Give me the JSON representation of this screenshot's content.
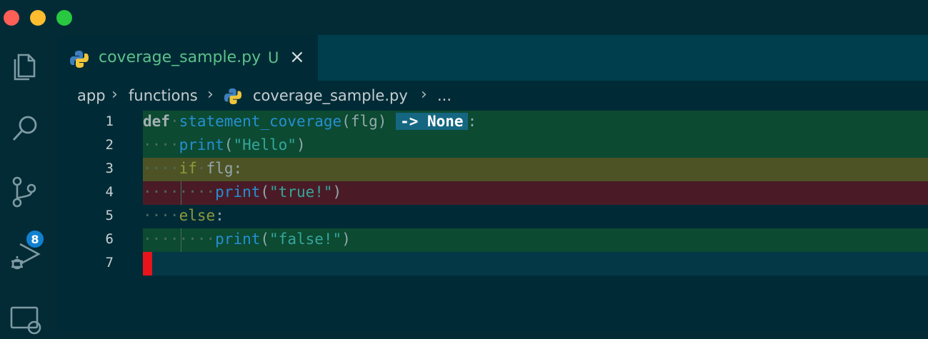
{
  "window": {
    "traffic_lights": [
      "close",
      "minimize",
      "zoom"
    ]
  },
  "activity_bar": {
    "items": [
      {
        "name": "explorer-icon"
      },
      {
        "name": "search-icon"
      },
      {
        "name": "source-control-icon",
        "badge": "8"
      },
      {
        "name": "run-debug-icon"
      },
      {
        "name": "remote-explorer-icon"
      }
    ]
  },
  "tab": {
    "label": "coverage_sample.py",
    "status": "U",
    "close": "×"
  },
  "breadcrumb": {
    "parts": [
      "app",
      "functions",
      "coverage_sample.py",
      "..."
    ]
  },
  "code": {
    "line_numbers": [
      "1",
      "2",
      "3",
      "4",
      "5",
      "6",
      "7"
    ],
    "l1": {
      "kw": "def",
      "dot": "·",
      "fn": "statement_coverage",
      "p1": "(",
      "arg": "flg",
      "p2": ")",
      "hint": "-> None",
      "colon": ":"
    },
    "l2": {
      "indent": "····",
      "fn": "print",
      "p1": "(",
      "str": "\"Hello\"",
      "p2": ")"
    },
    "l3": {
      "indent": "····",
      "kw": "if",
      "dot": "·",
      "arg": "flg",
      "colon": ":"
    },
    "l4": {
      "indent1": "····",
      "indent2": "····",
      "fn": "print",
      "p1": "(",
      "str": "\"true!\"",
      "p2": ")"
    },
    "l5": {
      "indent": "····",
      "kw": "else",
      "colon": ":"
    },
    "l6": {
      "indent1": "····",
      "indent2": "····",
      "fn": "print",
      "p1": "(",
      "str": "\"false!\"",
      "p2": ")"
    }
  },
  "colors": {
    "covered": "#0c4a32",
    "partial": "#4e5326",
    "missed": "#4a1b26",
    "badge": "#1180d0",
    "accent_green": "#5dc08a"
  }
}
